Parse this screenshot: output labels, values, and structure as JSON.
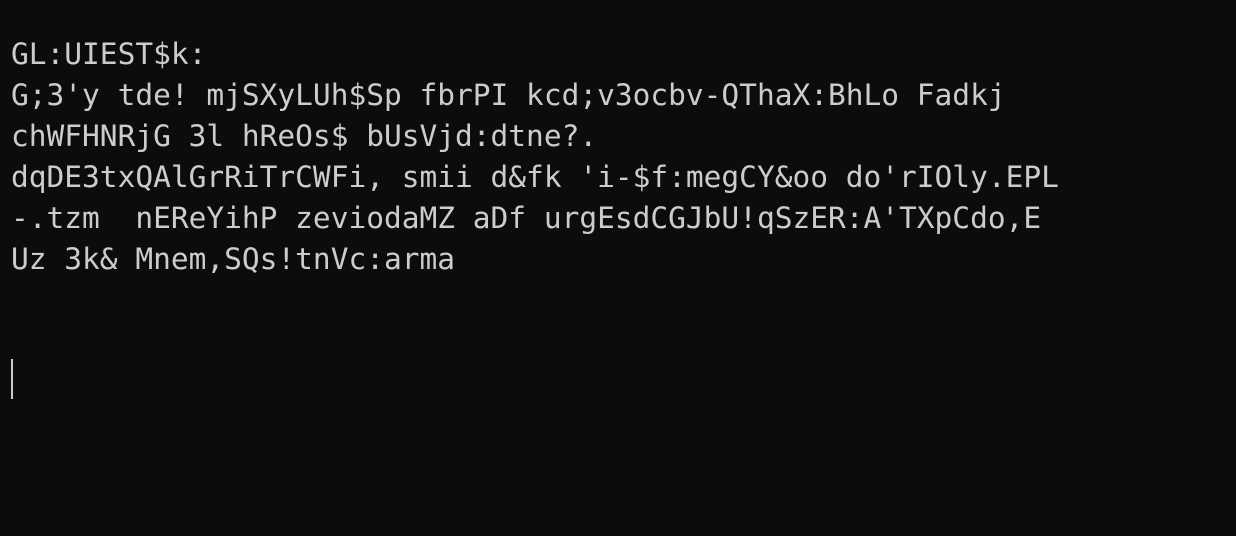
{
  "terminal": {
    "lines": [
      "GL:UIEST$k:",
      "G;3'y tde! mjSXyLUh$Sp fbrPI kcd;v3ocbv-QThaX:BhLo Fadkj",
      "chWFHNRjG 3l hReOs$ bUsVjd:dtne?.",
      "dqDE3txQAlGrRiTrCWFi, smii d&fk 'i-$f:megCY&oo do'rIOly.EPL",
      "-.tzm  nEReYihP zeviodaMZ aDf urgEsdCGJbU!qSzER:A'TXpCdo,E",
      "Uz 3k& Mnem,SQs!tnVc:arma"
    ],
    "colors": {
      "background": "#0c0c0c",
      "foreground": "#cccccc"
    }
  }
}
